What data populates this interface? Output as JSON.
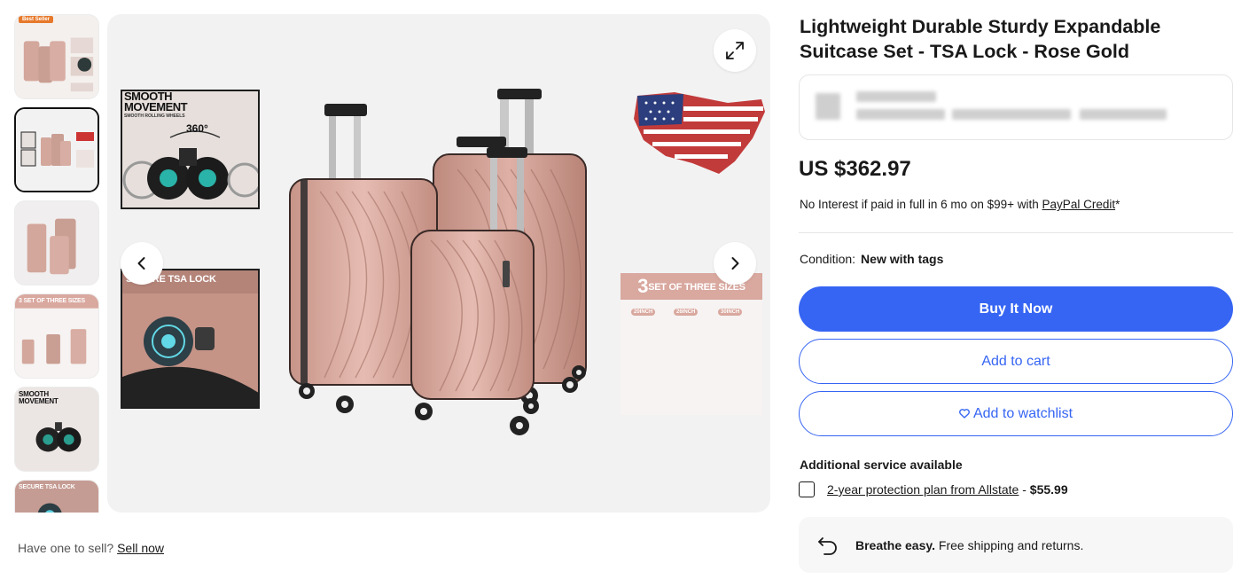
{
  "thumbnails": {
    "badge": "Best Seller",
    "smooth_title": "SMOOTH\nMOVEMENT",
    "angle": "360°",
    "tsa_title": "SECURE TSA LOCK",
    "sizes_title": "3 SET OF THREE SIZES"
  },
  "gallery": {
    "inset_smooth_title_1": "SMOOTH",
    "inset_smooth_title_2": "MOVEMENT",
    "inset_smooth_sub": "SMOOTH ROLLING WHEELS",
    "inset_angle": "360°",
    "inset_tsa_title": "SECURE TSA LOCK",
    "sizes_number": "3",
    "sizes_title": "SET OF THREE SIZES",
    "size_labels": [
      "20INCH",
      "26INCH",
      "30INCH"
    ]
  },
  "sell": {
    "prompt": "Have one to sell?",
    "link": "Sell now"
  },
  "listing": {
    "title": "Lightweight Durable Sturdy Expandable Suitcase Set - TSA Lock - Rose Gold",
    "price": "US $362.97",
    "finance_text": "No Interest if paid in full in 6 mo on $99+ with",
    "finance_link": "PayPal Credit",
    "finance_suffix": "*",
    "condition_label": "Condition:",
    "condition_value": "New with tags"
  },
  "actions": {
    "buy_now": "Buy It Now",
    "add_to_cart": "Add to cart",
    "add_to_watchlist": "Add to watchlist"
  },
  "services": {
    "heading": "Additional service available",
    "plan_link": "2-year protection plan from Allstate",
    "plan_sep": " - ",
    "plan_price": "$55.99"
  },
  "shipping": {
    "bold": "Breathe easy.",
    "text": " Free shipping and returns."
  },
  "colors": {
    "primary": "#3665f3",
    "rose_gold": "#d9a89f"
  }
}
